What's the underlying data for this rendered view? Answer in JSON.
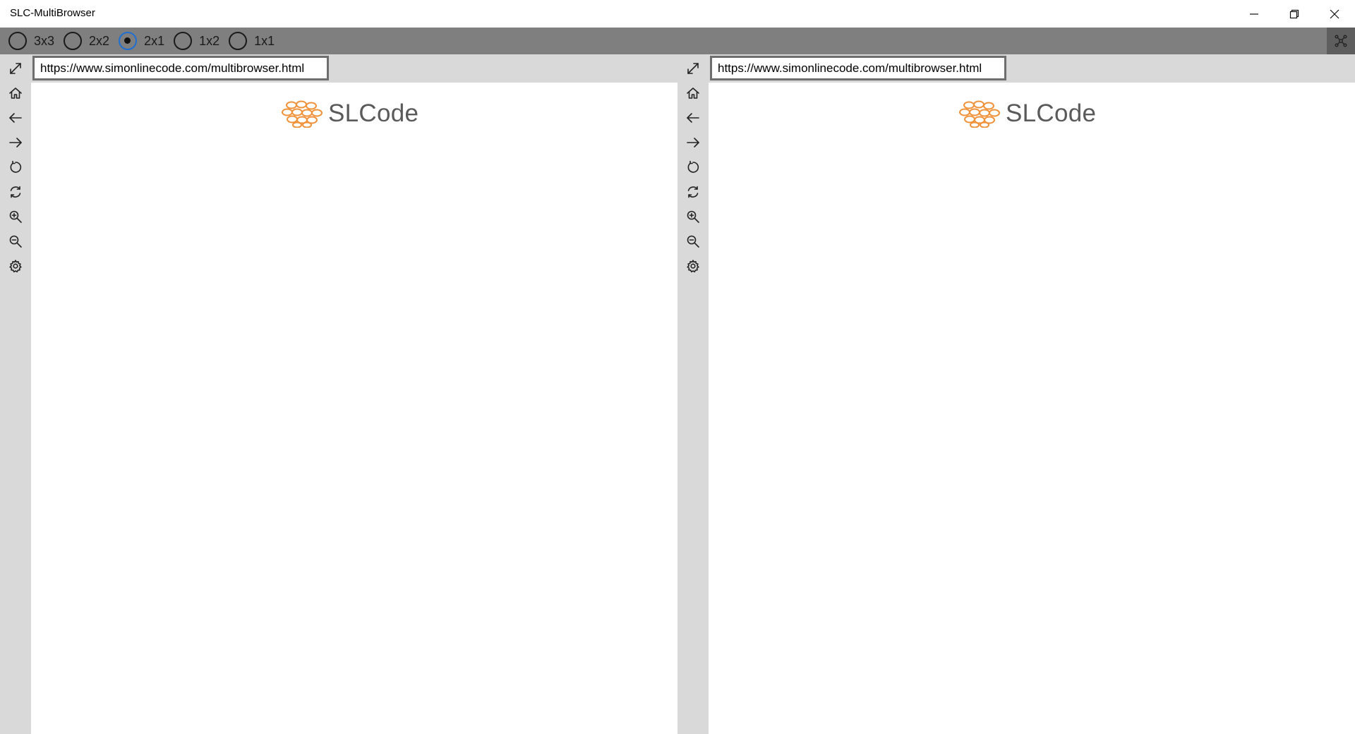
{
  "window": {
    "title": "SLC-MultiBrowser"
  },
  "layout_options": [
    {
      "label": "3x3",
      "checked": false
    },
    {
      "label": "2x2",
      "checked": false
    },
    {
      "label": "2x1",
      "checked": true
    },
    {
      "label": "1x2",
      "checked": false
    },
    {
      "label": "1x1",
      "checked": false
    }
  ],
  "panes": [
    {
      "url": "https://www.simonlinecode.com/multibrowser.html",
      "logo_text": "SLCode"
    },
    {
      "url": "https://www.simonlinecode.com/multibrowser.html",
      "logo_text": "SLCode"
    }
  ],
  "sidebar_icons": [
    "expand-icon",
    "home-icon",
    "back-arrow-icon",
    "forward-arrow-icon",
    "reload-icon",
    "sync-icon",
    "zoom-in-icon",
    "zoom-out-icon",
    "gear-icon"
  ],
  "colors": {
    "layout_bar": "#7f7f7f",
    "sidebar": "#d9d9d9",
    "logo_orange": "#f0923a",
    "radio_accent": "#1f6fd1"
  }
}
